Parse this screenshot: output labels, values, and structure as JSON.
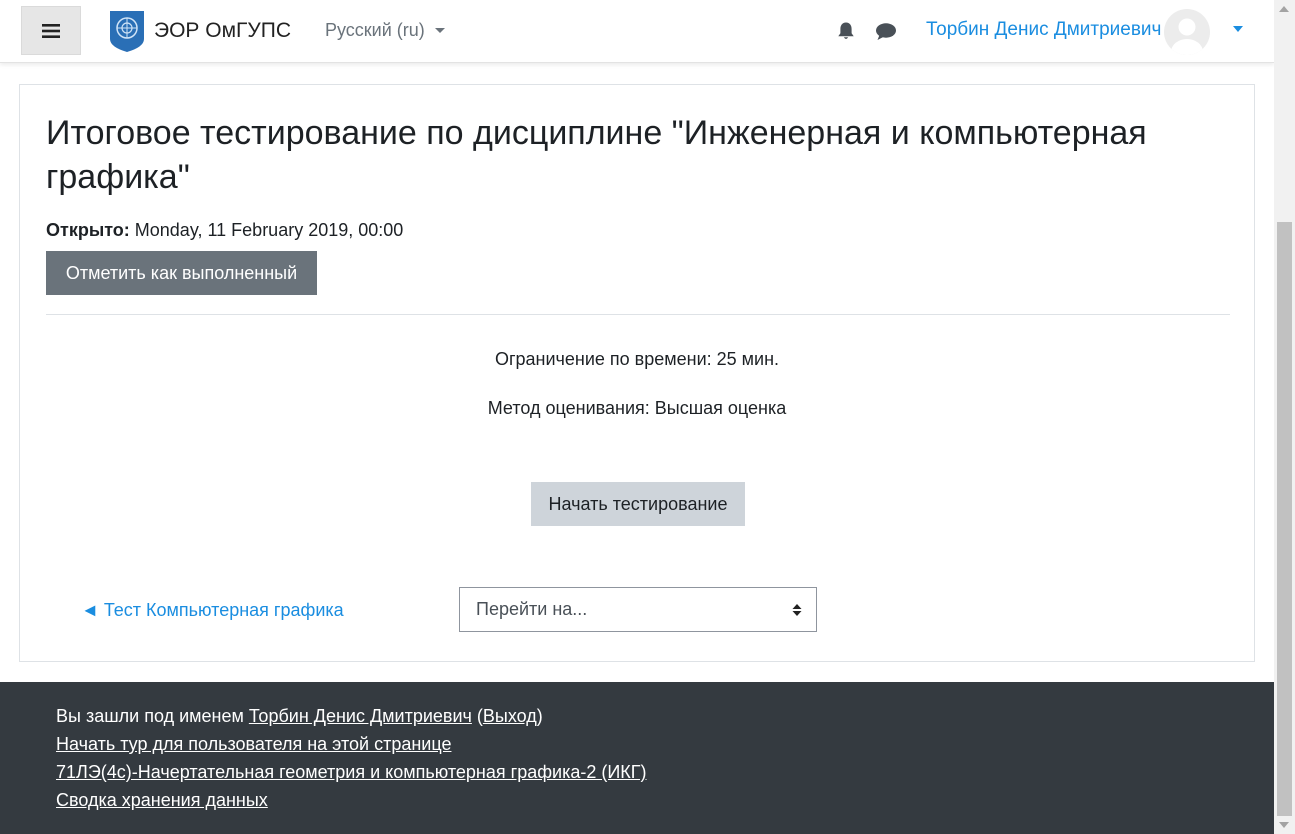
{
  "header": {
    "site_name": "ЭОР ОмГУПС",
    "language": "Русский ‎(ru)‎",
    "user_name": "Торбин Денис Дмитриевич"
  },
  "main": {
    "title": "Итоговое тестирование по дисциплине \"Инженерная и компьютерная графика\"",
    "opened_label": "Открыто:",
    "opened_value": "Monday, 11 February 2019, 00:00",
    "mark_done_button": "Отметить как выполненный",
    "time_limit": "Ограничение по времени: 25 мин.",
    "grading_method": "Метод оценивания: Высшая оценка",
    "start_button": "Начать тестирование",
    "prev_activity_link": "◄ Тест Компьютерная графика",
    "jump_to_placeholder": "Перейти на..."
  },
  "footer": {
    "logged_in_prefix": "Вы зашли под именем ",
    "logged_in_user": "Торбин Денис Дмитриевич",
    "logout_open": " (",
    "logout": "Выход",
    "logout_close": ")",
    "tour_link": "Начать тур для пользователя на этой странице",
    "course_link": "71ЛЭ(4с)-Начертательная геометрия и компьютерная графика-2 (ИКГ)",
    "data_retention_link": "Сводка хранения данных"
  },
  "colors": {
    "link": "#1a8de0",
    "footer_bg": "#343a40",
    "secondary_button": "#6a737b",
    "light_button": "#ced4da"
  },
  "icons": [
    "hamburger-icon",
    "university-emblem-logo",
    "bell-icon",
    "chat-bubble-icon",
    "user-avatar-icon",
    "select-arrows-icon"
  ]
}
